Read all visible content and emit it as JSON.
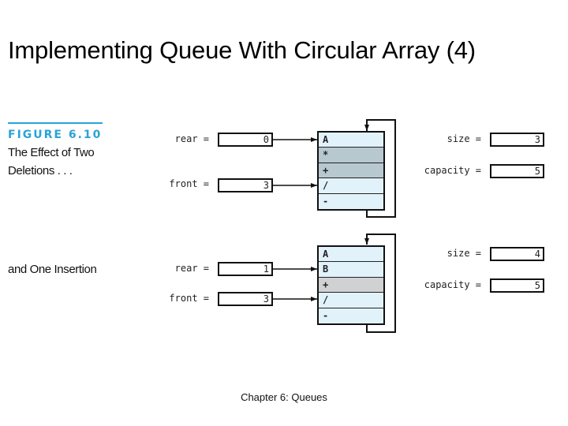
{
  "slide": {
    "title": "Implementing Queue With Circular Array (4)",
    "footer": "Chapter 6: Queues"
  },
  "figure": {
    "label": "FIGURE 6.10",
    "caption_line1": "The Effect of Two",
    "caption_line2": "Deletions . . .",
    "caption_line3": "and One Insertion",
    "accent_color": "#2aa3d6"
  },
  "states": [
    {
      "name": "after-two-deletions",
      "rear_label": "rear =",
      "rear_value": "0",
      "front_label": "front =",
      "front_value": "3",
      "size_label": "size =",
      "size_value": "3",
      "capacity_label": "capacity =",
      "capacity_value": "5",
      "cells": [
        {
          "value": "A",
          "state": "empty"
        },
        {
          "value": "*",
          "state": "filled"
        },
        {
          "value": "+",
          "state": "filled"
        },
        {
          "value": "/",
          "state": "empty"
        },
        {
          "value": "-",
          "state": "empty"
        }
      ]
    },
    {
      "name": "after-one-insertion",
      "rear_label": "rear =",
      "rear_value": "1",
      "front_label": "front =",
      "front_value": "3",
      "size_label": "size =",
      "size_value": "4",
      "capacity_label": "capacity =",
      "capacity_value": "5",
      "cells": [
        {
          "value": "A",
          "state": "empty"
        },
        {
          "value": "B",
          "state": "empty"
        },
        {
          "value": "+",
          "state": "gray"
        },
        {
          "value": "/",
          "state": "empty"
        },
        {
          "value": "-",
          "state": "empty"
        }
      ]
    }
  ]
}
